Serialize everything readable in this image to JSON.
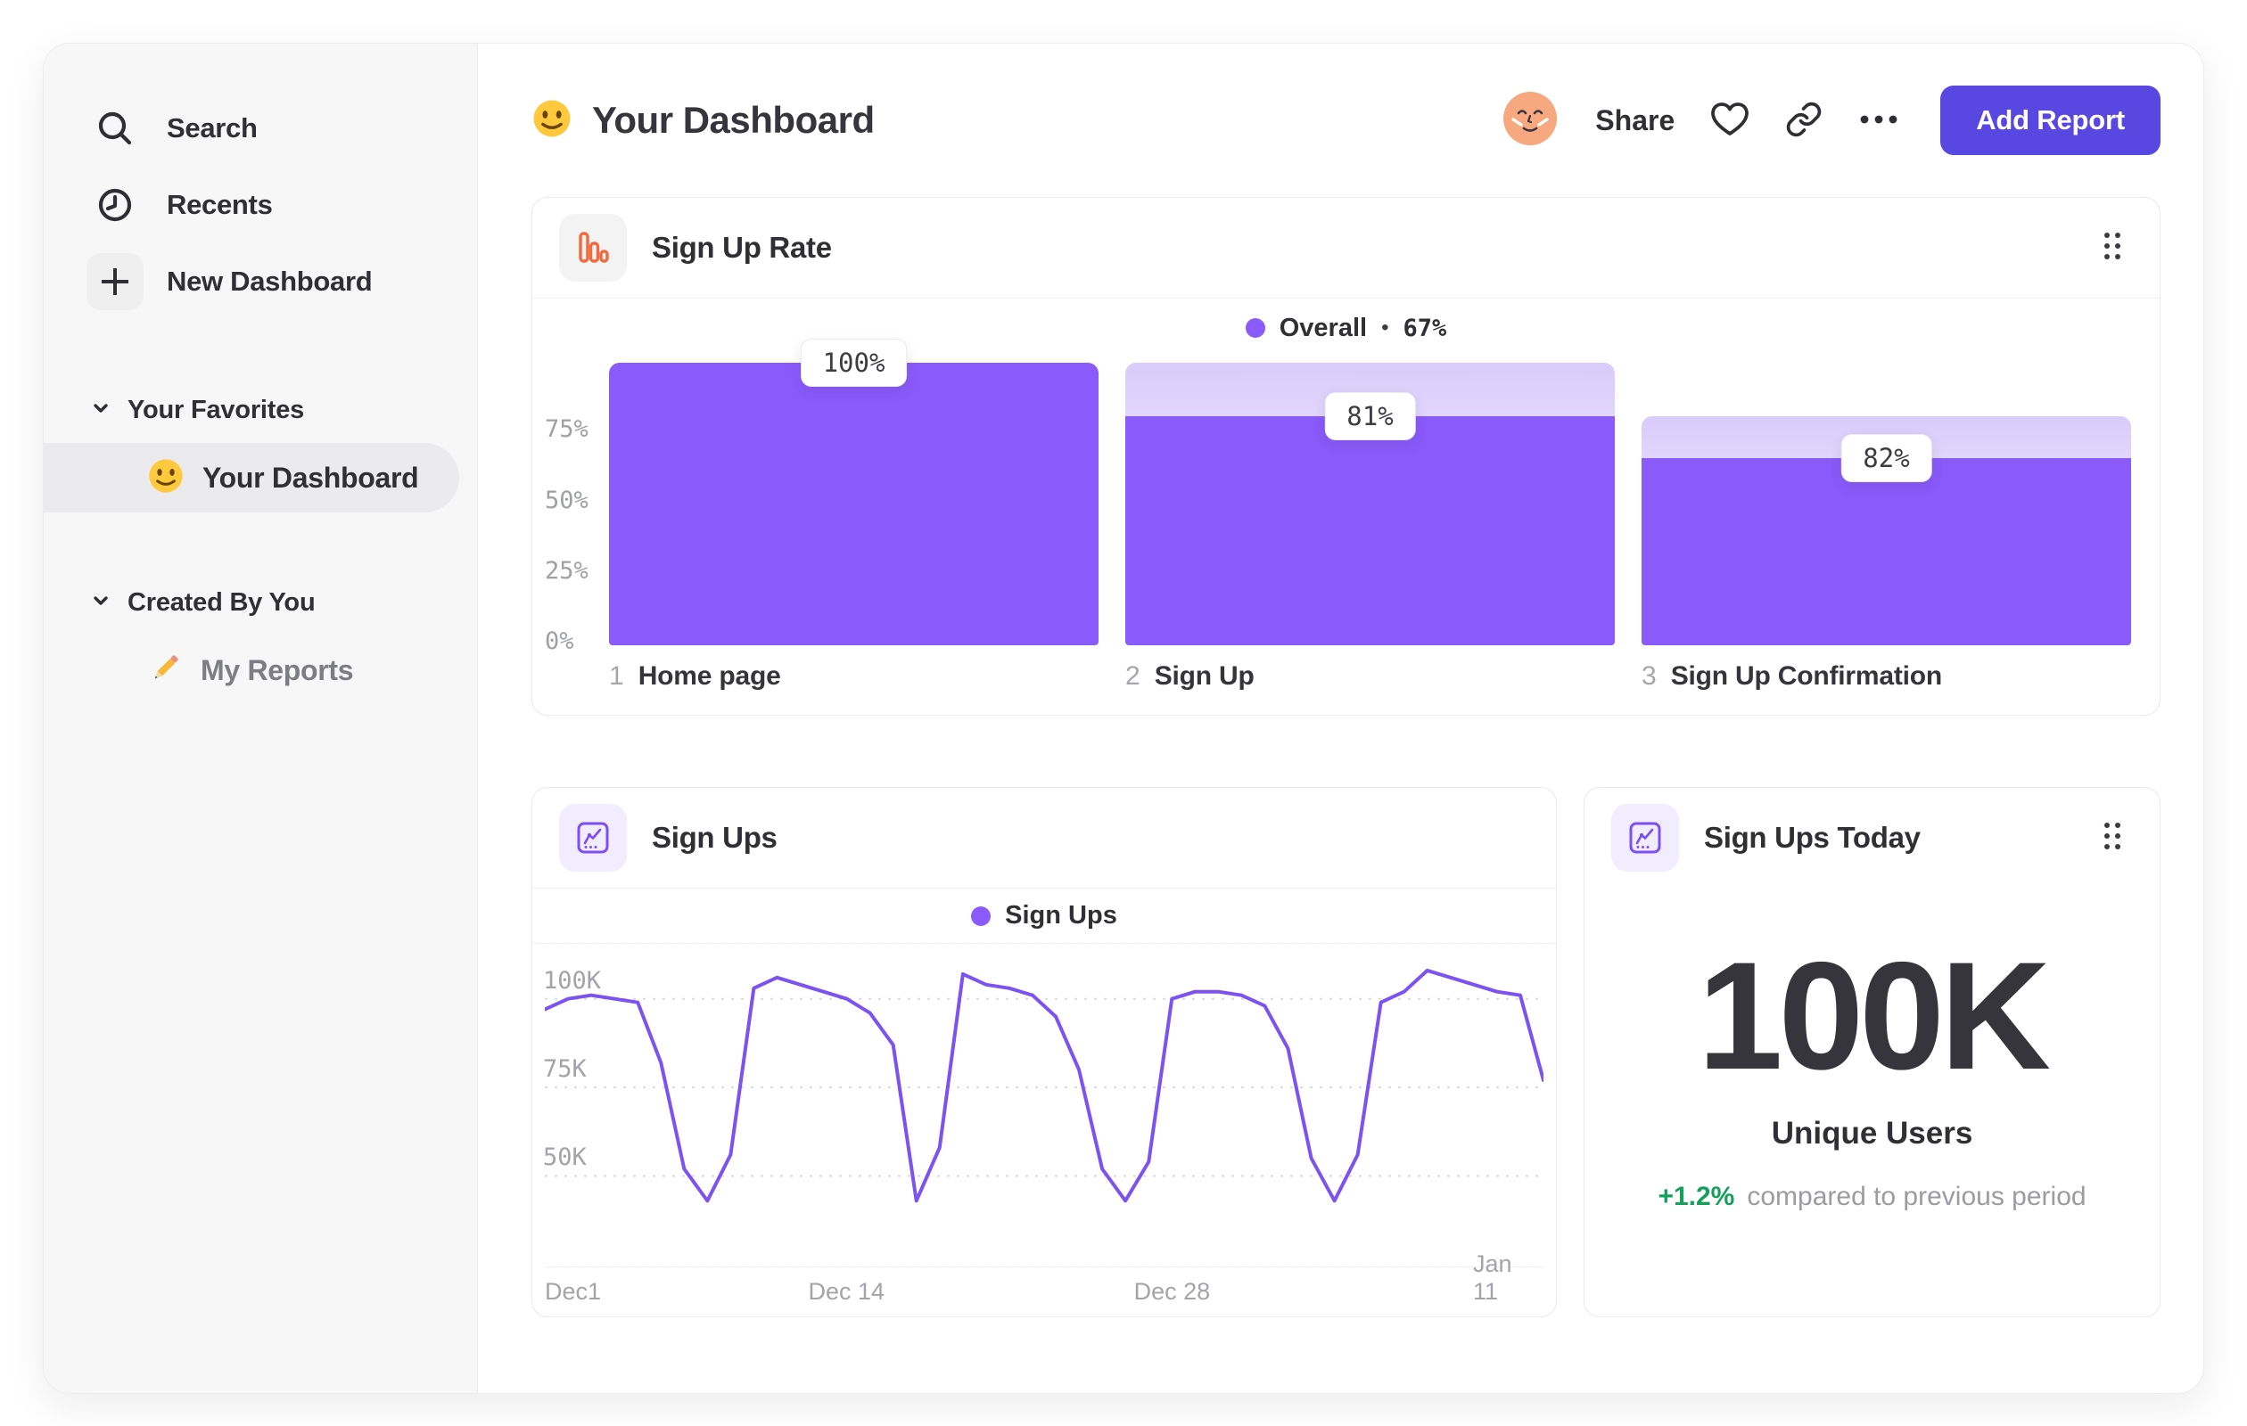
{
  "app": {
    "window_title": "Your Dashboard"
  },
  "colors": {
    "bar_purple": "#8a5afa",
    "line_purple": "#7c52f0",
    "button_indigo": "#5847e1",
    "funnel_icon_orange": "#f1693c",
    "delta_green": "#14a05a",
    "sidebar_bg": "#f7f7f8"
  },
  "sidebar": {
    "nav": [
      {
        "label": "Search",
        "icon": "search-icon"
      },
      {
        "label": "Recents",
        "icon": "clock-icon"
      },
      {
        "label": "New Dashboard",
        "icon": "plus-icon"
      }
    ],
    "sections": [
      {
        "label": "Your Favorites",
        "items": [
          {
            "label": "Your Dashboard",
            "icon": "smiley-emoji",
            "selected": true
          }
        ]
      },
      {
        "label": "Created By You",
        "items": [
          {
            "label": "My Reports",
            "icon": "pencil-emoji",
            "selected": false
          }
        ]
      }
    ]
  },
  "header": {
    "title": "Your Dashboard",
    "title_emoji": "smiley-emoji",
    "share_label": "Share",
    "add_report_label": "Add Report",
    "action_icons": [
      "avatar",
      "heart-icon",
      "link-icon",
      "ellipsis-icon"
    ]
  },
  "chart_data": [
    {
      "id": "sign_up_rate",
      "type": "bar",
      "subtype": "funnel",
      "title": "Sign Up Rate",
      "header_icon": "funnel-bars-icon",
      "legend": {
        "label": "Overall",
        "separator": "•",
        "value": "67%"
      },
      "step_numbers": [
        "1",
        "2",
        "3"
      ],
      "categories": [
        "Home page",
        "Sign Up",
        "Sign Up Confirmation"
      ],
      "step_labels": [
        "100%",
        "81%",
        "82%"
      ],
      "step_conversion_pct": [
        100,
        81,
        82
      ],
      "absolute_pct": [
        100,
        81,
        66.4
      ],
      "y_ticks": [
        "75%",
        "50%",
        "25%",
        "0%"
      ],
      "y_tick_values": [
        75,
        50,
        25,
        0
      ],
      "ylim": [
        0,
        100
      ],
      "bar_color": "#8a5afa"
    },
    {
      "id": "sign_ups",
      "type": "line",
      "title": "Sign Ups",
      "header_icon": "line-chart-icon",
      "legend": {
        "label": "Sign Ups"
      },
      "x_ticks": [
        "Dec1",
        "Dec 14",
        "Dec 28",
        "Jan 11"
      ],
      "x_tick_fractions": [
        0,
        0.302,
        0.628,
        0.953
      ],
      "y_ticks": [
        "100K",
        "75K",
        "50K"
      ],
      "y_tick_values_k": [
        100,
        75,
        50
      ],
      "ylim_k": [
        30,
        113
      ],
      "grid": "dashed-horizontal",
      "values_k": [
        97,
        100,
        101,
        100,
        99,
        82,
        52,
        43,
        56,
        103,
        106,
        104,
        102,
        100,
        96,
        87,
        43,
        58,
        107,
        104,
        103,
        101,
        95,
        80,
        52,
        43,
        54,
        100,
        102,
        102,
        101,
        98,
        86,
        55,
        43,
        56,
        99,
        102,
        108,
        106,
        104,
        102,
        101,
        77
      ],
      "line_color": "#7c52f0"
    },
    {
      "id": "sign_ups_today",
      "type": "kpi",
      "title": "Sign Ups Today",
      "header_icon": "line-chart-icon",
      "value": "100K",
      "label": "Unique Users",
      "delta": "+1.2%",
      "delta_text": "compared to previous period"
    }
  ]
}
